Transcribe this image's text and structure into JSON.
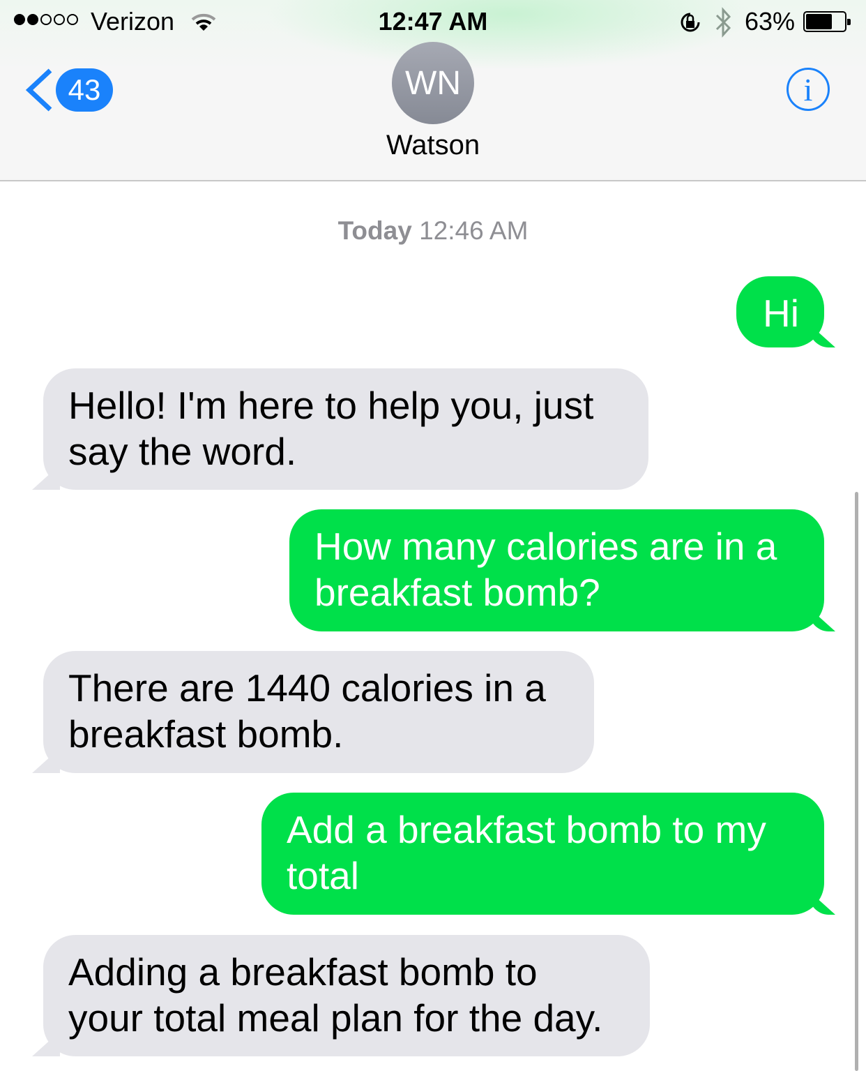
{
  "status_bar": {
    "signal_bars_filled": 2,
    "signal_bars_total": 5,
    "carrier": "Verizon",
    "time": "12:47 AM",
    "battery_percent_label": "63%",
    "battery_level": 0.63,
    "icons": [
      "wifi-icon",
      "orientation-lock-icon",
      "bluetooth-icon",
      "battery-icon"
    ]
  },
  "nav": {
    "back_count": "43",
    "avatar_initials": "WN",
    "contact_name": "Watson",
    "info_icon": "i",
    "accent": "#1a82fb"
  },
  "conversation": {
    "timestamp_day": "Today",
    "timestamp_time": "12:46 AM",
    "messages": [
      {
        "direction": "outgoing",
        "text": "Hi"
      },
      {
        "direction": "incoming",
        "text": "Hello! I'm here to help you, just\nsay the word."
      },
      {
        "direction": "outgoing",
        "text": "How many calories are in a\nbreakfast bomb?"
      },
      {
        "direction": "incoming",
        "text": "There are 1440 calories in a\nbreakfast bomb."
      },
      {
        "direction": "outgoing",
        "text": "Add a breakfast bomb to my\ntotal"
      },
      {
        "direction": "incoming",
        "text": "Adding a breakfast bomb to\nyour total meal plan for the day."
      }
    ],
    "colors": {
      "outgoing": "#00e04a",
      "incoming": "#e5e5ea"
    }
  }
}
